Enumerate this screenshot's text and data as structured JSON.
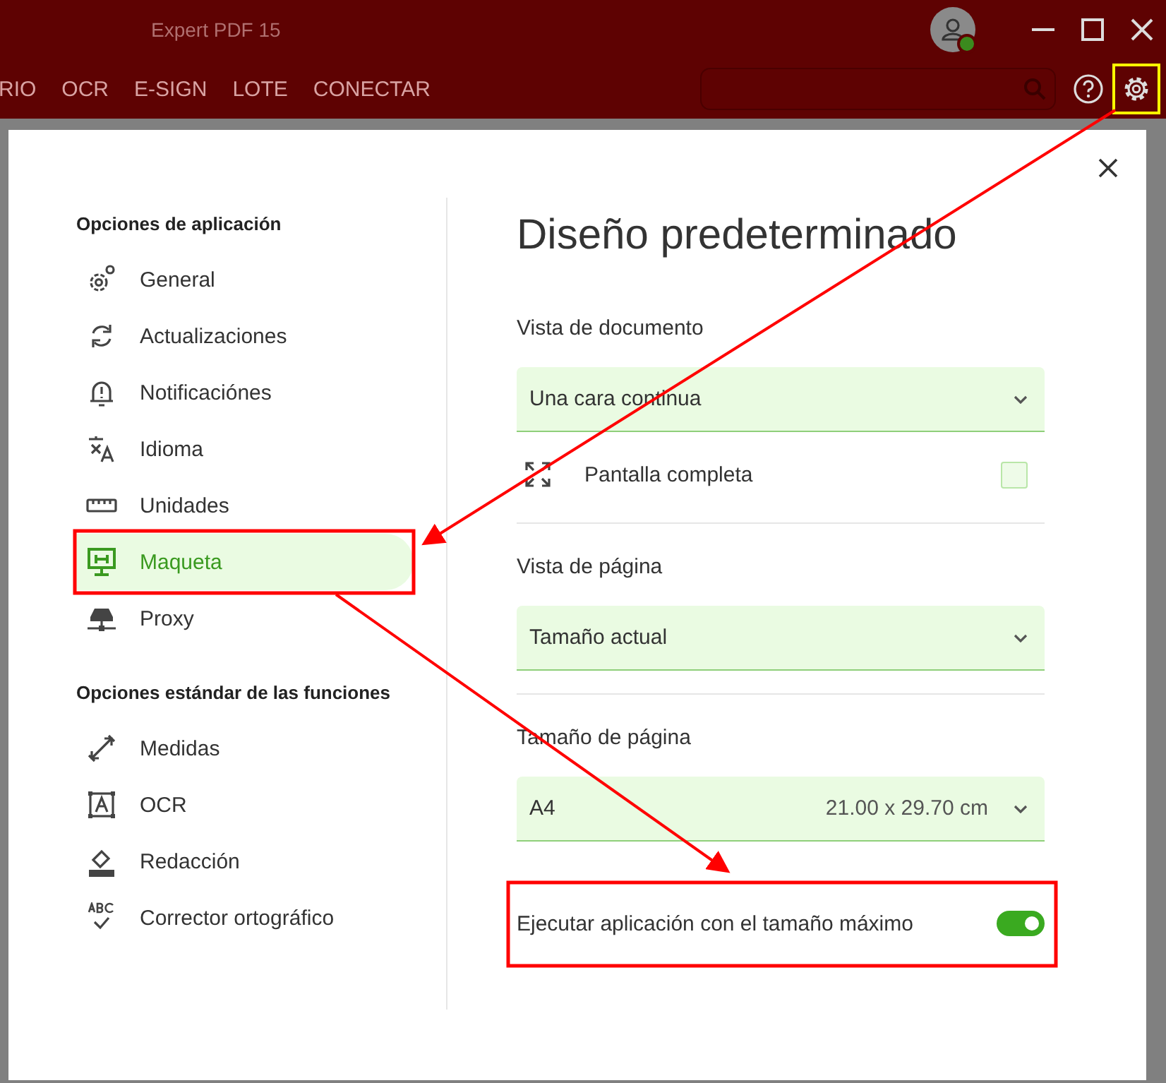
{
  "window": {
    "title": "Expert PDF 15"
  },
  "menu": [
    "RIO",
    "OCR",
    "E-SIGN",
    "LOTE",
    "CONECTAR"
  ],
  "dialog": {
    "sidebar": [
      {
        "heading": "Opciones de aplicación",
        "items": [
          {
            "label": "General",
            "selected": false
          },
          {
            "label": "Actualizaciones",
            "selected": false
          },
          {
            "label": "Notificaciónes",
            "selected": false
          },
          {
            "label": "Idioma",
            "selected": false
          },
          {
            "label": "Unidades",
            "selected": false
          },
          {
            "label": "Maqueta",
            "selected": true
          },
          {
            "label": "Proxy",
            "selected": false
          }
        ]
      },
      {
        "heading": "Opciones estándar de las funciones",
        "items": [
          {
            "label": "Medidas",
            "selected": false
          },
          {
            "label": "OCR",
            "selected": false
          },
          {
            "label": "Redacción",
            "selected": false
          },
          {
            "label": "Corrector ortográfico",
            "selected": false
          }
        ]
      }
    ],
    "title": "Diseño predeterminado",
    "settings": [
      {
        "label": "Vista de documento",
        "value": "Una cara continua",
        "option": {
          "label": "Pantalla completa",
          "checked": false
        }
      },
      {
        "label": "Vista de página",
        "value": "Tamaño actual"
      },
      {
        "label": "Tamaño de página",
        "value": "A4",
        "detail": "21.00 x 29.70 cm"
      }
    ],
    "toggle": {
      "label": "Ejecutar aplicación con el tamaño máximo",
      "on": true
    }
  }
}
